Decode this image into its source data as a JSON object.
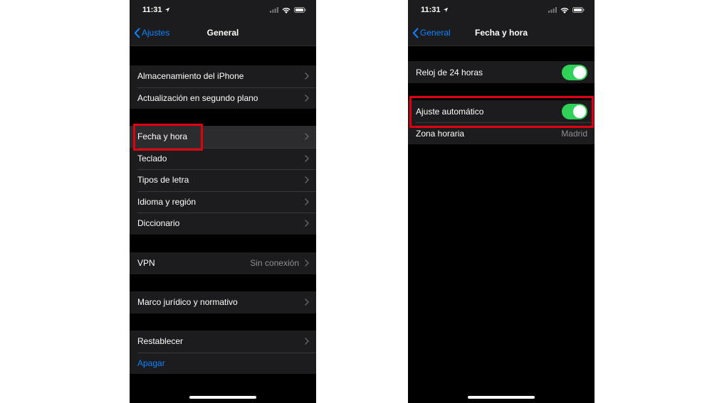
{
  "status_bar": {
    "time": "11:31"
  },
  "left_screen": {
    "back_label": "Ajustes",
    "title": "General",
    "groups": [
      [
        "Almacenamiento del iPhone",
        "Actualización en segundo plano"
      ],
      [
        "Fecha y hora",
        "Teclado",
        "Tipos de letra",
        "Idioma y región",
        "Diccionario"
      ],
      [
        {
          "label": "VPN",
          "value": "Sin conexión"
        }
      ],
      [
        "Marco jurídico y normativo"
      ],
      [
        "Restablecer",
        "Apagar"
      ]
    ]
  },
  "right_screen": {
    "back_label": "General",
    "title": "Fecha y hora",
    "rows": {
      "clock_24h": {
        "label": "Reloj de 24 horas",
        "state": "on"
      },
      "auto_set": {
        "label": "Ajuste automático",
        "state": "on"
      },
      "time_zone": {
        "label": "Zona horaria",
        "value": "Madrid"
      }
    }
  },
  "colors": {
    "accent": "#0a84ff",
    "toggle_on": "#30d158",
    "highlight_box": "#e0000f",
    "cell_background": "#1c1c1e",
    "screen_background": "#000000"
  }
}
